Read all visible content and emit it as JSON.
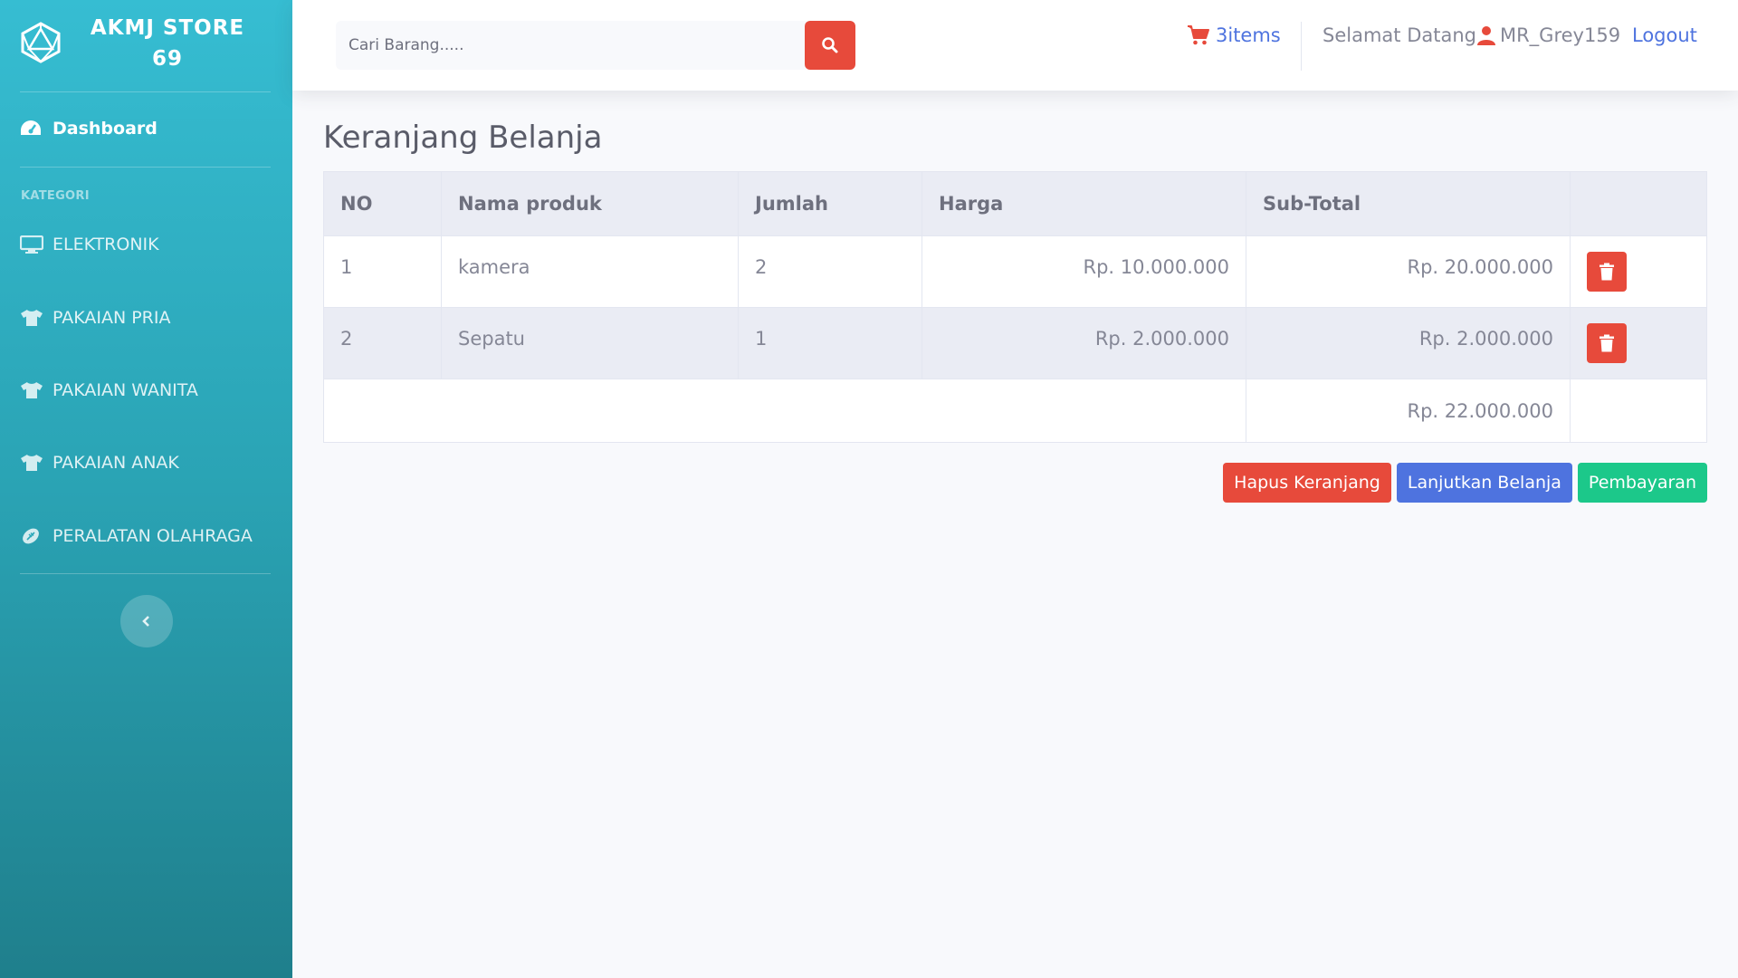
{
  "brand": {
    "line1": "AKMJ STORE",
    "line2": "69"
  },
  "sidebar": {
    "dashboard": "Dashboard",
    "heading": "KATEGORI",
    "items": [
      {
        "label": "ELEKTRONIK",
        "icon": "desktop-icon"
      },
      {
        "label": "PAKAIAN PRIA",
        "icon": "tshirt-icon"
      },
      {
        "label": "PAKAIAN WANITA",
        "icon": "tshirt-icon"
      },
      {
        "label": "PAKAIAN ANAK",
        "icon": "tshirt-icon"
      },
      {
        "label": "PERALATAN OLAHRAGA",
        "icon": "football-icon"
      }
    ]
  },
  "topbar": {
    "search_placeholder": "Cari Barang.....",
    "cart_label": "3items",
    "welcome": "Selamat Datang",
    "username": "MR_Grey159",
    "logout": "Logout"
  },
  "page": {
    "title": "Keranjang Belanja"
  },
  "table": {
    "headers": [
      "NO",
      "Nama produk",
      "Jumlah",
      "Harga",
      "Sub-Total",
      ""
    ],
    "rows": [
      {
        "no": "1",
        "name": "kamera",
        "qty": "2",
        "price": "Rp. 10.000.000",
        "subtotal": "Rp. 20.000.000"
      },
      {
        "no": "2",
        "name": "Sepatu",
        "qty": "1",
        "price": "Rp. 2.000.000",
        "subtotal": "Rp. 2.000.000"
      }
    ],
    "total": "Rp. 22.000.000"
  },
  "actions": {
    "clear": "Hapus Keranjang",
    "continue": "Lanjutkan Belanja",
    "pay": "Pembayaran"
  },
  "colors": {
    "sidebar_top": "#36bdd2",
    "danger": "#e74a3b",
    "primary": "#4e73df",
    "success": "#1cc88a"
  }
}
